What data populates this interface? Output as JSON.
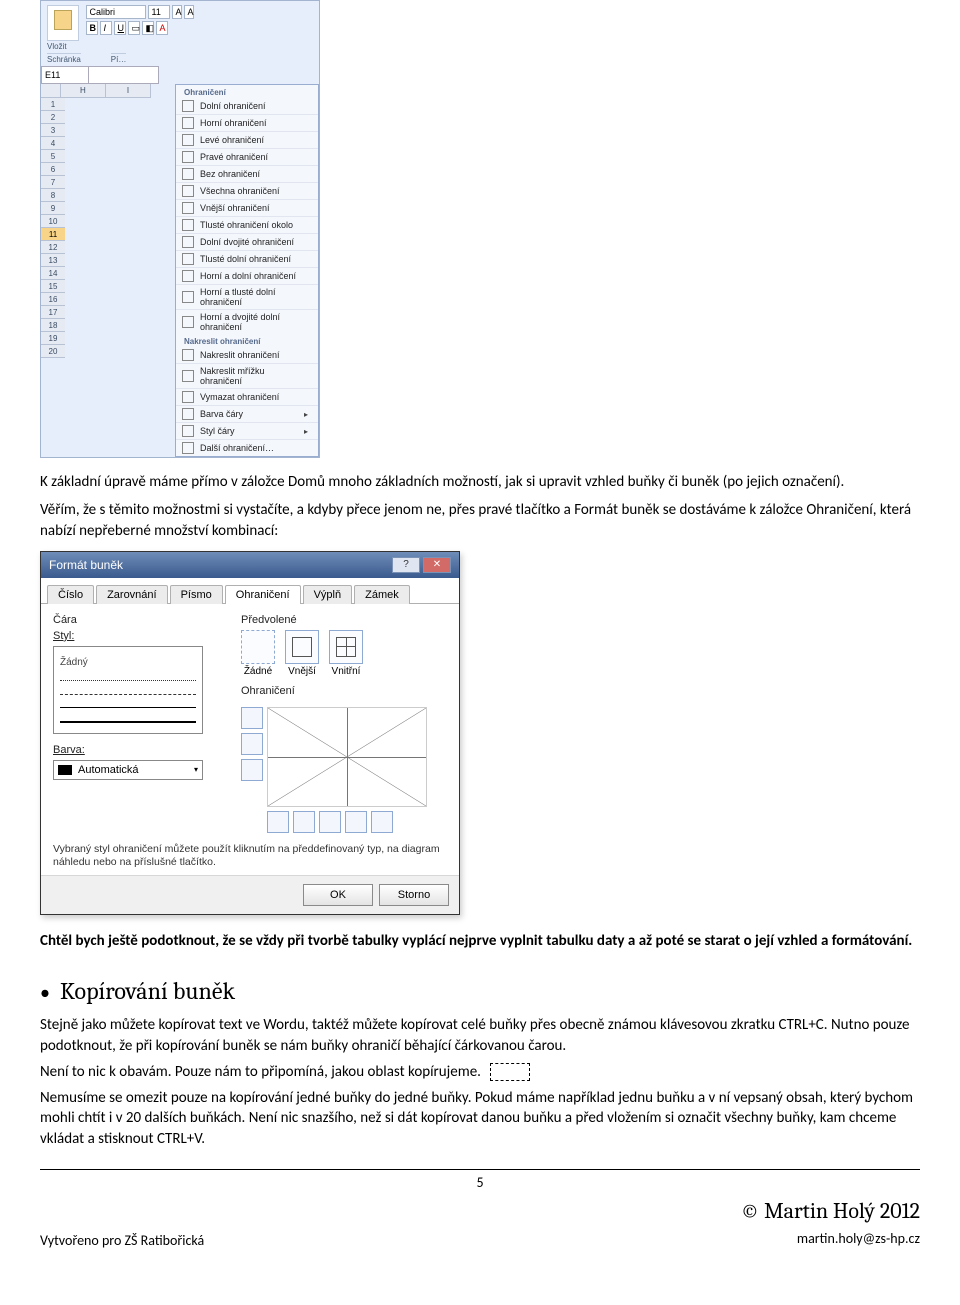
{
  "excelShot": {
    "font": "Calibri",
    "fontSize": "11",
    "pasteLabel": "Vložit",
    "groupClipboard": "Schránka",
    "groupFont": "Pí…",
    "nameBox": "E11",
    "columns": [
      "H",
      "I"
    ],
    "rows": [
      "1",
      "2",
      "3",
      "4",
      "5",
      "6",
      "7",
      "8",
      "9",
      "10",
      "11",
      "12",
      "13",
      "14",
      "15",
      "16",
      "17",
      "18",
      "19",
      "20"
    ],
    "selectedRow": "11",
    "menuTitle1": "Ohraničení",
    "menuTitle2": "Nakreslit ohraničení",
    "items1": [
      "Dolní ohraničení",
      "Horní ohraničení",
      "Levé ohraničení",
      "Pravé ohraničení",
      "Bez ohraničení",
      "Všechna ohraničení",
      "Vnější ohraničení",
      "Tlusté ohraničení okolo",
      "Dolní dvojité ohraničení",
      "Tlusté dolní ohraničení",
      "Horní a dolní ohraničení",
      "Horní a tlusté dolní ohraničení",
      "Horní a dvojité dolní ohraničení"
    ],
    "items2": [
      "Nakreslit ohraničení",
      "Nakreslit mřížku ohraničení",
      "Vymazat ohraničení",
      "Barva čáry",
      "Styl čáry",
      "Další ohraničení…"
    ]
  },
  "para1": "K základní úpravě máme přímo v záložce Domů mnoho základních možností, jak si upravit vzhled buňky či buněk (po jejich označení).",
  "para2": "Věřím, že s těmito možnostmi si vystačíte, a kdyby přece jenom ne, přes pravé tlačítko a Formát buněk se dostáváme k záložce Ohraničení, která nabízí nepřeberné množství kombinací:",
  "dlg": {
    "title": "Formát buněk",
    "tabs": [
      "Číslo",
      "Zarovnání",
      "Písmo",
      "Ohraničení",
      "Výplň",
      "Zámek"
    ],
    "activeTab": "Ohraničení",
    "lineLabel": "Čára",
    "styleLabel": "Styl:",
    "styleNone": "Žádný",
    "colorLabel": "Barva:",
    "colorValue": "Automatická",
    "presetLabel": "Předvolené",
    "presetNone": "Žádné",
    "presetOutline": "Vnější",
    "presetInside": "Vnitřní",
    "borderLabel": "Ohraničení",
    "hint": "Vybraný styl ohraničení můžete použít kliknutím na předdefinovaný typ, na diagram náhledu nebo na příslušné tlačítko.",
    "ok": "OK",
    "cancel": "Storno"
  },
  "para3": "Chtěl bych ještě podotknout, že se vždy při tvorbě tabulky vyplácí nejprve vyplnit tabulku daty a až poté se starat o její vzhled a formátování.",
  "h2": "Kopírování buněk",
  "para4": "Stejně jako můžete kopírovat text ve Wordu, taktéž můžete kopírovat celé buňky přes obecně známou klávesovou zkratku CTRL+C. Nutno pouze podotknout, že při kopírování buněk se nám buňky ohraničí běhající čárkovanou čarou.",
  "para5": "Není to nic k obavám. Pouze nám to připomíná, jakou oblast kopírujeme.",
  "para6": "Nemusíme se omezit pouze na kopírování jedné buňky do jedné buňky. Pokud máme například jednu buňku a v ní vepsaný obsah, který bychom mohli chtít i v 20 dalších buňkách. Není nic snazšího, než si dát kopírovat danou buňku a před vložením si označit všechny buňky, kam chceme vkládat a stisknout CTRL+V.",
  "footerLeft": "Vytvořeno pro ZŠ Ratibořická",
  "pageNum": "5",
  "author": "© Martin Holý 2012",
  "email": "martin.holy@zs-hp.cz"
}
